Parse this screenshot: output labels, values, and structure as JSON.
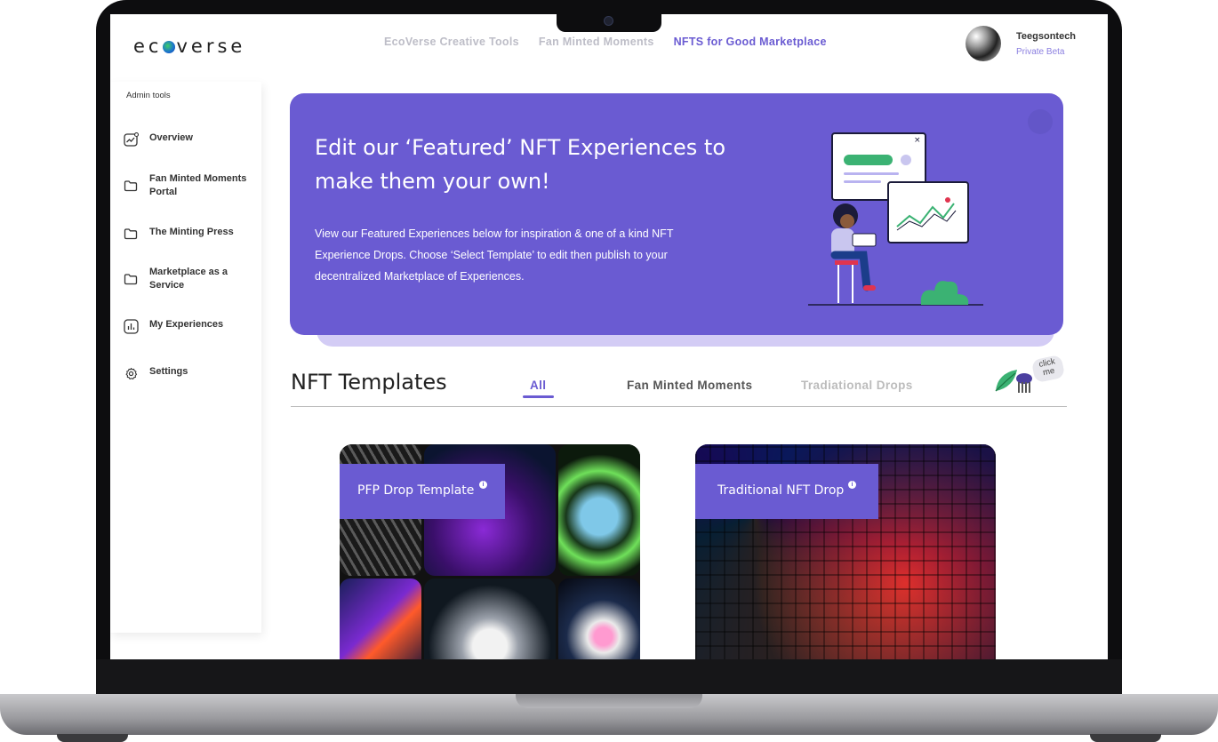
{
  "brand": {
    "logo_prefix": "ec",
    "logo_suffix": "verse"
  },
  "topnav": {
    "items": [
      {
        "label": "EcoVerse Creative Tools",
        "active": false
      },
      {
        "label": "Fan Minted Moments",
        "active": false
      },
      {
        "label": "NFTS for Good Marketplace",
        "active": true
      }
    ]
  },
  "user": {
    "name": "Teegsontech",
    "role": "Private Beta"
  },
  "sidebar": {
    "section_label": "Admin tools",
    "items": [
      {
        "label": "Overview",
        "icon": "chart-icon"
      },
      {
        "label": "Fan Minted Moments Portal",
        "icon": "folder-icon"
      },
      {
        "label": "The Minting Press",
        "icon": "folder-icon"
      },
      {
        "label": "Marketplace as a Service",
        "icon": "folder-icon"
      },
      {
        "label": "My Experiences",
        "icon": "bar-chart-icon"
      },
      {
        "label": "Settings",
        "icon": "gear-icon"
      }
    ]
  },
  "hero": {
    "title": "Edit our ‘Featured’ NFT Experiences to make them your own!",
    "description": "View our Featured Experiences below for inspiration & one of a kind NFT Experience Drops.   Choose ‘Select Template’ to edit then publish to your decentralized Marketplace of Experiences."
  },
  "templates": {
    "title": "NFT Templates",
    "tabs": [
      {
        "label": "All",
        "active": true
      },
      {
        "label": "Fan Minted Moments",
        "active": false
      },
      {
        "label": "Tradiational Drops",
        "active": false
      }
    ],
    "click_me": "click me",
    "cards": [
      {
        "label": "PFP Drop Template",
        "info": "i"
      },
      {
        "label": "Traditional NFT Drop",
        "info": "i"
      }
    ]
  },
  "colors": {
    "accent": "#6a5bd2",
    "hero_bg": "#6a5bd2",
    "nav_inactive": "#bdbdc7"
  }
}
